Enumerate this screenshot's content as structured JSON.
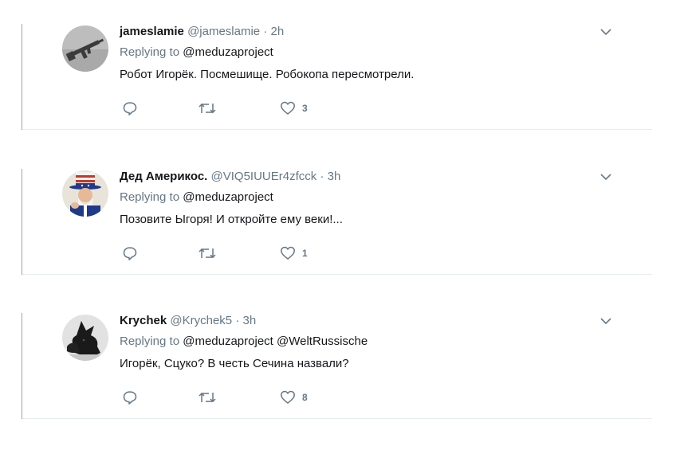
{
  "replying_to_label": "Replying to",
  "separator": "·",
  "tweets": [
    {
      "name": "jameslamie",
      "handle": "@jameslamie",
      "time": "2h",
      "mentions": [
        "@meduzaproject"
      ],
      "text": "Робот Игорёк. Посмешище. Робокопа пересмотрели.",
      "likes": "3",
      "avatar_icon": "rifle-avatar"
    },
    {
      "name": "Дед Америкос.",
      "handle": "@VIQ5IUUEr4zfcck",
      "time": "3h",
      "mentions": [
        "@meduzaproject"
      ],
      "text": "Позовите Ыгоря! И откройте ему веки!...",
      "likes": "1",
      "avatar_icon": "uncle-sam-avatar"
    },
    {
      "name": "Krychek",
      "handle": "@Krychek5",
      "time": "3h",
      "mentions": [
        "@meduzaproject",
        "@WeltRussische"
      ],
      "text": "Игорёк, Сцуко? В честь Сечина назвали?",
      "likes": "8",
      "avatar_icon": "black-dog-avatar"
    }
  ],
  "colors": {
    "text": "#14171a",
    "secondary": "#657786",
    "divider": "#e6ecf0",
    "icon": "#657786"
  }
}
